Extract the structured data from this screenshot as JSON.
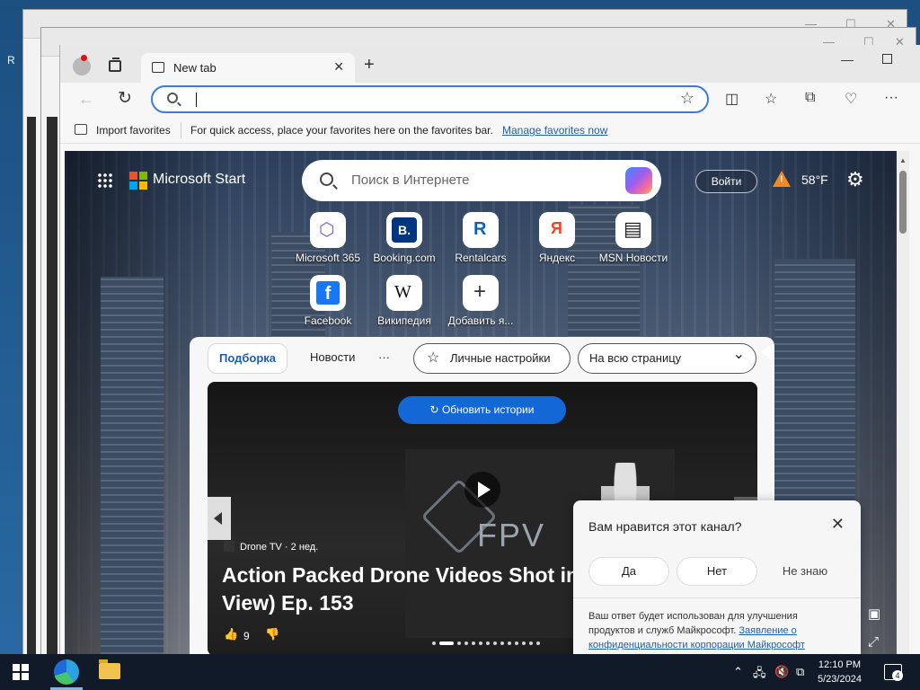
{
  "desktop": {
    "side_letter": "R"
  },
  "browser": {
    "tab": {
      "title": "New tab",
      "close_icon": "close-icon"
    },
    "new_tab_icon": "+",
    "address": {
      "placeholder": "",
      "value": ""
    },
    "favorites_bar": {
      "import_label": "Import favorites",
      "hint": "For quick access, place your favorites here on the favorites bar.",
      "manage_link": "Manage favorites now"
    }
  },
  "start_page": {
    "brand": "Microsoft Start",
    "search_placeholder": "Поиск в Интернете",
    "login_label": "Войти",
    "weather": {
      "temp": "58°F"
    },
    "tiles": [
      {
        "label": "Microsoft 365",
        "glyph": "⬡",
        "color": "#7b5ce0"
      },
      {
        "label": "Booking.com",
        "glyph": "B.",
        "color": "#003580"
      },
      {
        "label": "Rentalcars",
        "glyph": "R",
        "color": "#0b62c4"
      },
      {
        "label": "Яндекс",
        "glyph": "Я",
        "color": "#fc3f1d"
      },
      {
        "label": "MSN Новости",
        "glyph": "▤",
        "color": "#222222"
      },
      {
        "label": "Facebook",
        "glyph": "f",
        "color": "#1877f2"
      },
      {
        "label": "Википедия",
        "glyph": "W",
        "color": "#111111"
      },
      {
        "label": "Добавить я...",
        "glyph": "+",
        "color": "#333333"
      }
    ],
    "feed_tabs": {
      "active": "Подборка",
      "news": "Новости",
      "more": "···",
      "personalize": "Личные настройки",
      "layout_select": "На всю страницу"
    },
    "hero": {
      "refresh_label": "Обновить истории",
      "refresh_icon": "↻",
      "logo_text": "FPV",
      "source": "Drone TV · 2 нед.",
      "headline": "Action Packed Drone Videos Shot in First Person View) Ep. 153",
      "likes": "9"
    }
  },
  "feedback_popup": {
    "question": "Вам нравится этот канал?",
    "yes": "Да",
    "no": "Нет",
    "dont_know": "Не знаю",
    "note": "Ваш ответ будет использован для улучшения продуктов и служб Майкрософт.",
    "privacy_link": "Заявление о конфиденциальности корпорации Майкрософт"
  },
  "taskbar": {
    "time": "12:10 PM",
    "date": "5/23/2024",
    "notifications": "4"
  }
}
